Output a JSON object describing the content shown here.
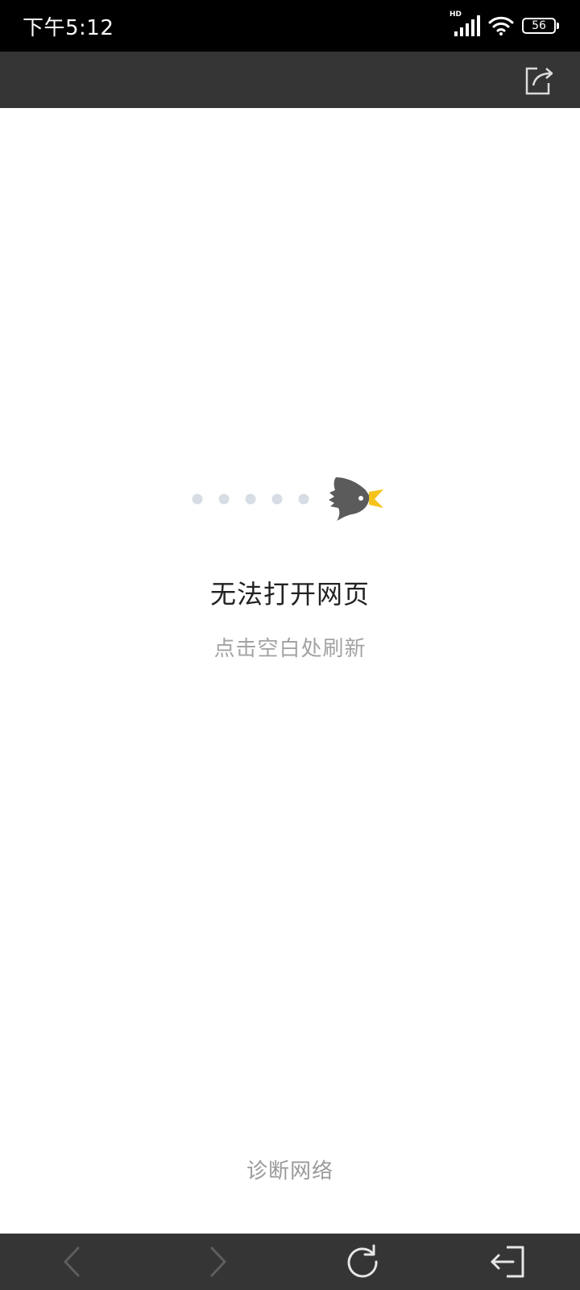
{
  "status_bar": {
    "time": "下午5:12",
    "network_label": "HD",
    "battery_level": "56"
  },
  "toolbar": {
    "share_icon": "share-icon"
  },
  "error": {
    "title": "无法打开网页",
    "subtitle": "点击空白处刷新",
    "illustration": "bird-flying-illustration"
  },
  "footer": {
    "diagnose_label": "诊断网络"
  },
  "bottom_nav": {
    "items": [
      {
        "icon": "back-arrow-icon",
        "enabled": false
      },
      {
        "icon": "forward-arrow-icon",
        "enabled": false
      },
      {
        "icon": "refresh-icon",
        "enabled": true
      },
      {
        "icon": "exit-icon",
        "enabled": true
      }
    ]
  },
  "colors": {
    "status_bar_bg": "#000000",
    "toolbar_bg": "#353535",
    "title_text": "#222222",
    "subtitle_text": "#a3a3a3",
    "bird_body": "#5b5b5b",
    "bird_beak": "#f5c31c",
    "dots": "#d7dde4"
  }
}
